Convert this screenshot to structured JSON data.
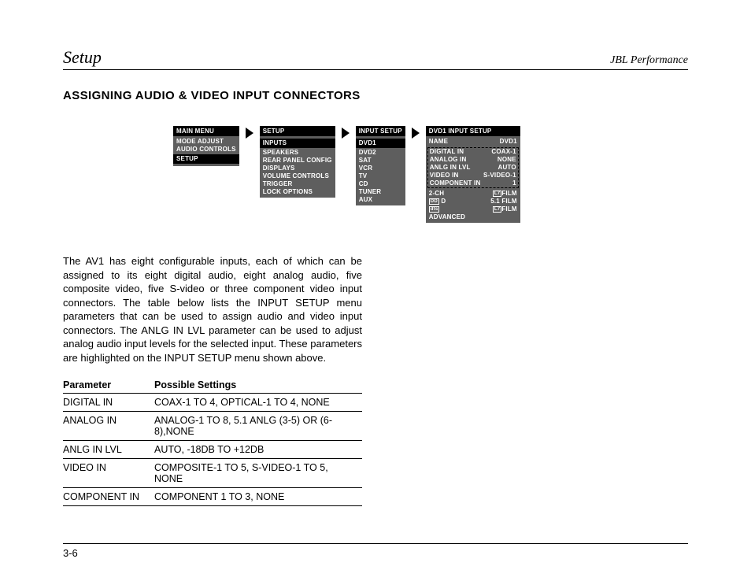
{
  "header": {
    "left": "Setup",
    "right": "JBL Performance"
  },
  "section_title": "ASSIGNING AUDIO & VIDEO INPUT CONNECTORS",
  "menus": {
    "m1": {
      "title": "MAIN MENU",
      "items": [
        "MODE ADJUST",
        "AUDIO CONTROLS",
        "SETUP"
      ],
      "highlight": "SETUP"
    },
    "m2": {
      "title": "SETUP",
      "items": [
        "INPUTS",
        "SPEAKERS",
        "REAR PANEL CONFIG",
        "DISPLAYS",
        "VOLUME CONTROLS",
        "TRIGGER",
        "LOCK OPTIONS"
      ],
      "highlight": "INPUTS"
    },
    "m3": {
      "title": "INPUT SETUP",
      "items": [
        "DVD1",
        "DVD2",
        "SAT",
        "VCR",
        "TV",
        "CD",
        "TUNER",
        "AUX"
      ],
      "highlight": "DVD1"
    },
    "m4": {
      "title": "DVD1 INPUT SETUP",
      "rows": [
        {
          "l": "NAME",
          "r": "DVD1"
        },
        {
          "l": "DIGITAL IN",
          "r": "COAX-1"
        },
        {
          "l": "ANALOG IN",
          "r": "NONE"
        },
        {
          "l": "ANLG IN LVL",
          "r": "AUTO"
        },
        {
          "l": "VIDEO IN",
          "r": "S-VIDEO-1"
        },
        {
          "l": "COMPONENT IN",
          "r": "1"
        }
      ],
      "mode_rows": [
        {
          "l": "2-CH",
          "r": "FILM"
        },
        {
          "l": "D",
          "r": "5.1 FILM"
        },
        {
          "l": " ",
          "r": "FILM"
        }
      ],
      "advanced": "ADVANCED"
    }
  },
  "paragraph": "The AV1 has eight configurable inputs, each of which can be assigned to its eight digital audio, eight analog audio, five composite video, five S-video or three component video input connectors. The table below lists the INPUT SETUP menu parameters that can be used to assign audio and video input connectors. The ANLG IN LVL parameter can be used to adjust analog audio input levels for the selected input. These parameters are highlighted on the INPUT SETUP menu shown above.",
  "table": {
    "head": [
      "Parameter",
      "Possible Settings"
    ],
    "rows": [
      [
        "DIGITAL IN",
        "COAX-1 TO 4, OPTICAL-1 TO 4, NONE"
      ],
      [
        "ANALOG IN",
        "ANALOG-1 TO 8, 5.1 ANLG (3-5) OR (6-8),NONE"
      ],
      [
        "ANLG IN LVL",
        "AUTO, -18DB TO +12DB"
      ],
      [
        "VIDEO IN",
        "COMPOSITE-1 TO 5, S-VIDEO-1 TO 5, NONE"
      ],
      [
        "COMPONENT IN",
        "COMPONENT 1 TO 3, NONE"
      ]
    ]
  },
  "page_number": "3-6"
}
